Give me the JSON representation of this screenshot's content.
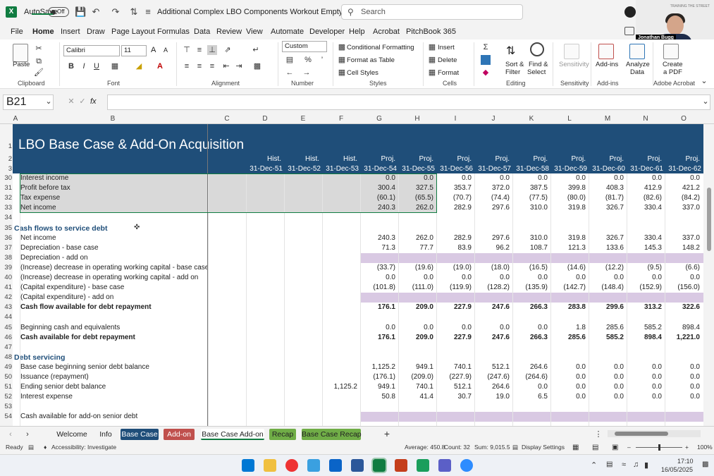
{
  "titlebar": {
    "app_icon": "excel-icon",
    "autosave_label": "AutoSave",
    "autosave_state": "Off",
    "filename": "Additional Complex LBO Components Workout Empty.xlsx  -  E...",
    "search_placeholder": "Search"
  },
  "webcam": {
    "name": "Jonathan Bugg",
    "brand": "TRAINING THE STREET"
  },
  "menu": [
    "File",
    "Home",
    "Insert",
    "Draw",
    "Page Layout",
    "Formulas",
    "Data",
    "Review",
    "View",
    "Automate",
    "Developer",
    "Help",
    "Acrobat",
    "PitchBook 365"
  ],
  "ribbon": {
    "clipboard": {
      "paste": "Paste",
      "label": "Clipboard"
    },
    "font": {
      "name": "Calibri",
      "size": "11",
      "grow": "A",
      "shrink": "A",
      "label": "Font"
    },
    "alignment": {
      "label": "Alignment"
    },
    "number": {
      "format": "Custom",
      "label": "Number"
    },
    "styles": {
      "conditional": "Conditional Formatting",
      "table": "Format as Table",
      "cell": "Cell Styles",
      "label": "Styles"
    },
    "cells": {
      "insert": "Insert",
      "delete": "Delete",
      "format": "Format",
      "label": "Cells"
    },
    "editing": {
      "sort": "Sort &",
      "filter": "Filter",
      "find": "Find &",
      "select": "Select",
      "label": "Editing"
    },
    "sensitivity": {
      "btn": "Sensitivity",
      "label": "Sensitivity"
    },
    "addins": {
      "btn": "Add-ins",
      "label": "Add-ins"
    },
    "analyze": {
      "line1": "Analyze",
      "line2": "Data"
    },
    "acrobat": {
      "line1": "Create",
      "line2": "a PDF",
      "label": "Adobe Acrobat"
    }
  },
  "formula_bar": {
    "name_box": "B21",
    "fx": "fx",
    "content": ""
  },
  "columns": [
    "A",
    "B",
    "C",
    "D",
    "E",
    "F",
    "G",
    "H",
    "I",
    "J",
    "K",
    "L",
    "M",
    "N",
    "O"
  ],
  "sheet": {
    "title": "LBO Base Case & Add-On Acquisition",
    "hdr_type": [
      "Hist.",
      "Hist.",
      "Hist.",
      "Proj.",
      "Proj.",
      "Proj.",
      "Proj.",
      "Proj.",
      "Proj.",
      "Proj.",
      "Proj.",
      "Proj."
    ],
    "hdr_date": [
      "31-Dec-51",
      "31-Dec-52",
      "31-Dec-53",
      "31-Dec-54",
      "31-Dec-55",
      "31-Dec-56",
      "31-Dec-57",
      "31-Dec-58",
      "31-Dec-59",
      "31-Dec-60",
      "31-Dec-61",
      "31-Dec-62"
    ],
    "rows": [
      {
        "n": "30",
        "label": "Interest income",
        "vals": [
          "",
          "",
          "",
          "0.0",
          "0.0",
          "0.0",
          "0.0",
          "0.0",
          "0.0",
          "0.0",
          "0.0",
          "0.0"
        ]
      },
      {
        "n": "31",
        "label": "Profit before tax",
        "vals": [
          "",
          "",
          "",
          "300.4",
          "327.5",
          "353.7",
          "372.0",
          "387.5",
          "399.8",
          "408.3",
          "412.9",
          "421.2"
        ]
      },
      {
        "n": "32",
        "label": "Tax expense",
        "vals": [
          "",
          "",
          "",
          "(60.1)",
          "(65.5)",
          "(70.7)",
          "(74.4)",
          "(77.5)",
          "(80.0)",
          "(81.7)",
          "(82.6)",
          "(84.2)"
        ]
      },
      {
        "n": "33",
        "label": "Net income",
        "vals": [
          "",
          "",
          "",
          "240.3",
          "262.0",
          "282.9",
          "297.6",
          "310.0",
          "319.8",
          "326.7",
          "330.4",
          "337.0"
        ]
      },
      {
        "n": "34",
        "label": "",
        "vals": []
      },
      {
        "n": "35",
        "label": "Cash flows to service debt",
        "section": true,
        "vals": []
      },
      {
        "n": "36",
        "label": "Net income",
        "vals": [
          "",
          "",
          "",
          "240.3",
          "262.0",
          "282.9",
          "297.6",
          "310.0",
          "319.8",
          "326.7",
          "330.4",
          "337.0"
        ]
      },
      {
        "n": "37",
        "label": "Depreciation - base case",
        "vals": [
          "",
          "",
          "",
          "71.3",
          "77.7",
          "83.9",
          "96.2",
          "108.7",
          "121.3",
          "133.6",
          "145.3",
          "148.2"
        ]
      },
      {
        "n": "38",
        "label": "Depreciation - add on",
        "purple": true,
        "vals": []
      },
      {
        "n": "39",
        "label": "(Increase) decrease in operating working capital - base case",
        "vals": [
          "",
          "",
          "",
          "(33.7)",
          "(19.6)",
          "(19.0)",
          "(18.0)",
          "(16.5)",
          "(14.6)",
          "(12.2)",
          "(9.5)",
          "(6.6)"
        ]
      },
      {
        "n": "40",
        "label": "(Increase) decrease in operating working capital - add on",
        "vals": [
          "",
          "",
          "",
          "0.0",
          "0.0",
          "0.0",
          "0.0",
          "0.0",
          "0.0",
          "0.0",
          "0.0",
          "0.0"
        ]
      },
      {
        "n": "41",
        "label": "(Capital expenditure) - base case",
        "vals": [
          "",
          "",
          "",
          "(101.8)",
          "(111.0)",
          "(119.9)",
          "(128.2)",
          "(135.9)",
          "(142.7)",
          "(148.4)",
          "(152.9)",
          "(156.0)"
        ]
      },
      {
        "n": "42",
        "label": "(Capital expenditure) - add on",
        "purple": true,
        "vals": []
      },
      {
        "n": "43",
        "label": "Cash flow available for debt repayment",
        "bold": true,
        "vals": [
          "",
          "",
          "",
          "176.1",
          "209.0",
          "227.9",
          "247.6",
          "266.3",
          "283.8",
          "299.6",
          "313.2",
          "322.6"
        ]
      },
      {
        "n": "44",
        "label": "",
        "vals": []
      },
      {
        "n": "45",
        "label": "Beginning cash and equivalents",
        "vals": [
          "",
          "",
          "",
          "0.0",
          "0.0",
          "0.0",
          "0.0",
          "0.0",
          "1.8",
          "285.6",
          "585.2",
          "898.4"
        ]
      },
      {
        "n": "46",
        "label": "Cash available for debt repayment",
        "bold": true,
        "vals": [
          "",
          "",
          "",
          "176.1",
          "209.0",
          "227.9",
          "247.6",
          "266.3",
          "285.6",
          "585.2",
          "898.4",
          "1,221.0"
        ]
      },
      {
        "n": "47",
        "label": "",
        "vals": []
      },
      {
        "n": "48",
        "label": "Debt servicing",
        "section": true,
        "vals": []
      },
      {
        "n": "49",
        "label": "Base case beginning senior debt balance",
        "vals": [
          "",
          "",
          "",
          "1,125.2",
          "949.1",
          "740.1",
          "512.1",
          "264.6",
          "0.0",
          "0.0",
          "0.0",
          "0.0"
        ]
      },
      {
        "n": "50",
        "label": "Issuance (repayment)",
        "vals": [
          "",
          "",
          "",
          "(176.1)",
          "(209.0)",
          "(227.9)",
          "(247.6)",
          "(264.6)",
          "0.0",
          "0.0",
          "0.0",
          "0.0"
        ]
      },
      {
        "n": "51",
        "label": "Ending senior debt balance",
        "vals": [
          "",
          "",
          "1,125.2",
          "949.1",
          "740.1",
          "512.1",
          "264.6",
          "0.0",
          "0.0",
          "0.0",
          "0.0",
          "0.0"
        ]
      },
      {
        "n": "52",
        "label": "Interest expense",
        "vals": [
          "",
          "",
          "",
          "50.8",
          "41.4",
          "30.7",
          "19.0",
          "6.5",
          "0.0",
          "0.0",
          "0.0",
          "0.0"
        ]
      },
      {
        "n": "53",
        "label": "",
        "vals": []
      },
      {
        "n": "54",
        "label": "Cash available for add-on senior debt",
        "purple": true,
        "vals": []
      }
    ]
  },
  "tabs": [
    {
      "label": "Welcome",
      "style": "plain"
    },
    {
      "label": "Info",
      "style": "plain"
    },
    {
      "label": "Base Case",
      "style": "blue"
    },
    {
      "label": "Add-on",
      "style": "red"
    },
    {
      "label": "Base Case Add-on",
      "style": "active"
    },
    {
      "label": "Recap",
      "style": "green"
    },
    {
      "label": "Base Case Recap",
      "style": "green"
    }
  ],
  "status": {
    "ready": "Ready",
    "accessibility": "Accessibility: Investigate",
    "average": "Average: 450.8",
    "count": "Count: 32",
    "sum": "Sum: 9,015.5",
    "display": "Display Settings",
    "zoom": "100%"
  },
  "taskbar": {
    "time": "17:10",
    "date": "16/05/2025"
  },
  "colors": {
    "accent": "#107c41",
    "header_blue": "#1f4e79",
    "section_blue": "#1f4e79",
    "purple_fill": "#d9c9e3",
    "selection_fill": "#d9d9d9"
  }
}
